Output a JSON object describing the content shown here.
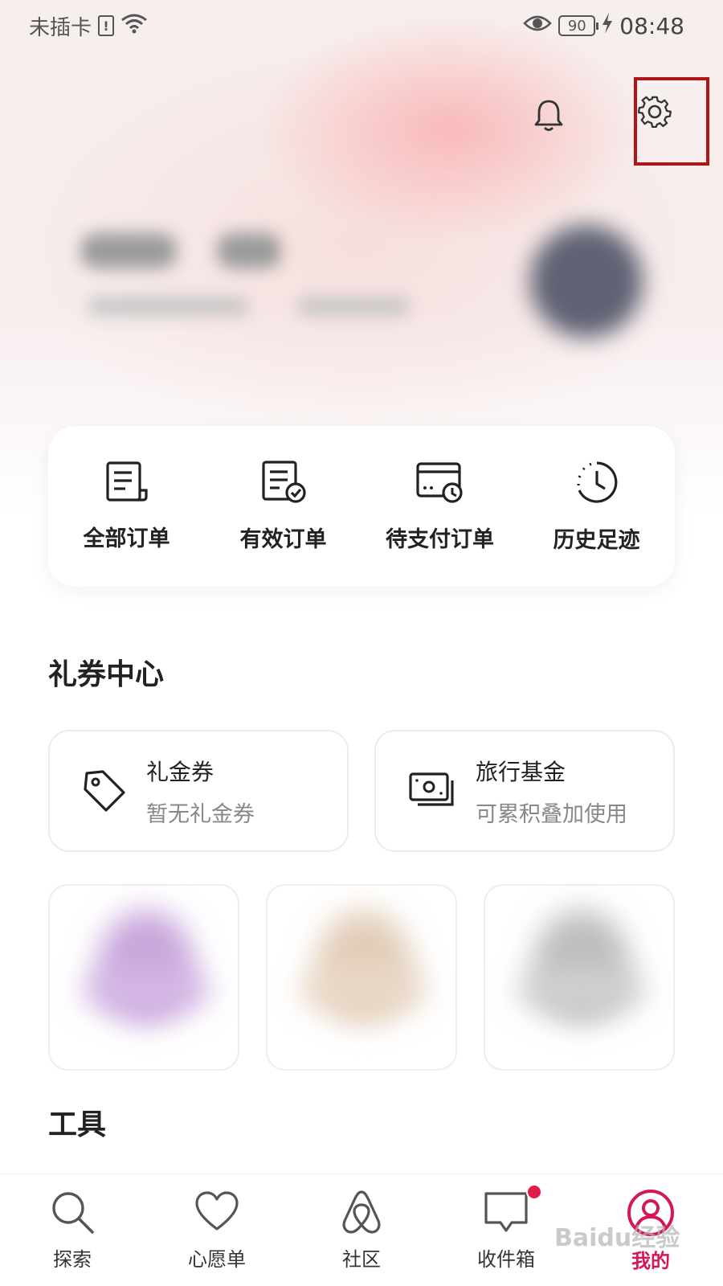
{
  "status_bar": {
    "carrier": "未插卡",
    "sim_symbol": "!",
    "battery": "90",
    "time": "08:48"
  },
  "header": {
    "icons": [
      "bell-icon",
      "gear-icon"
    ],
    "highlight_color": "#b01414"
  },
  "orders": [
    {
      "label": "全部订单",
      "icon": "all-orders-icon"
    },
    {
      "label": "有效订单",
      "icon": "valid-orders-icon"
    },
    {
      "label": "待支付订单",
      "icon": "pending-payment-icon"
    },
    {
      "label": "历史足迹",
      "icon": "history-icon"
    }
  ],
  "coupon_section": {
    "title": "礼券中心",
    "cards": [
      {
        "title": "礼金券",
        "subtitle": "暂无礼金券",
        "icon": "tag-icon"
      },
      {
        "title": "旅行基金",
        "subtitle": "可累积叠加使用",
        "icon": "money-icon"
      }
    ]
  },
  "tools_section": {
    "title": "工具"
  },
  "bottom_nav": {
    "items": [
      {
        "label": "探索",
        "icon": "search-icon"
      },
      {
        "label": "心愿单",
        "icon": "heart-icon"
      },
      {
        "label": "社区",
        "icon": "airbnb-logo-icon"
      },
      {
        "label": "收件箱",
        "icon": "message-icon"
      },
      {
        "label": "我的",
        "icon": "profile-icon"
      }
    ],
    "active_color": "#d5165a",
    "badge_color": "#e21b47"
  },
  "watermark": "Baidu经验"
}
